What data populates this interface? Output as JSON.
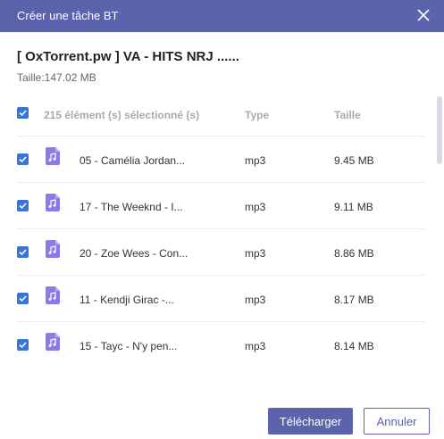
{
  "dialog": {
    "title": "Créer une tâche BT",
    "torrent_name": "[ OxTorrent.pw ] VA - HITS NRJ ......",
    "size_info": "Taille:147.02 MB"
  },
  "list": {
    "selection_label": "215 élément (s) sélectionné (s)",
    "col_type": "Type",
    "col_size": "Taille",
    "rows": [
      {
        "name": "05 - Camélia Jordan...",
        "type": "mp3",
        "size": "9.45 MB"
      },
      {
        "name": "17 - The Weeknd - I...",
        "type": "mp3",
        "size": "9.11 MB"
      },
      {
        "name": "20 - Zoe Wees - Con...",
        "type": "mp3",
        "size": "8.86 MB"
      },
      {
        "name": "11 - Kendji Girac -...",
        "type": "mp3",
        "size": "8.17 MB"
      },
      {
        "name": "15 - Tayc - N'y pen...",
        "type": "mp3",
        "size": "8.14 MB"
      }
    ]
  },
  "buttons": {
    "download": "Télécharger",
    "cancel": "Annuler"
  },
  "colors": {
    "accent": "#5b63ad",
    "checkbox": "#3b73d9",
    "file_icon": "#8a7ce8"
  }
}
